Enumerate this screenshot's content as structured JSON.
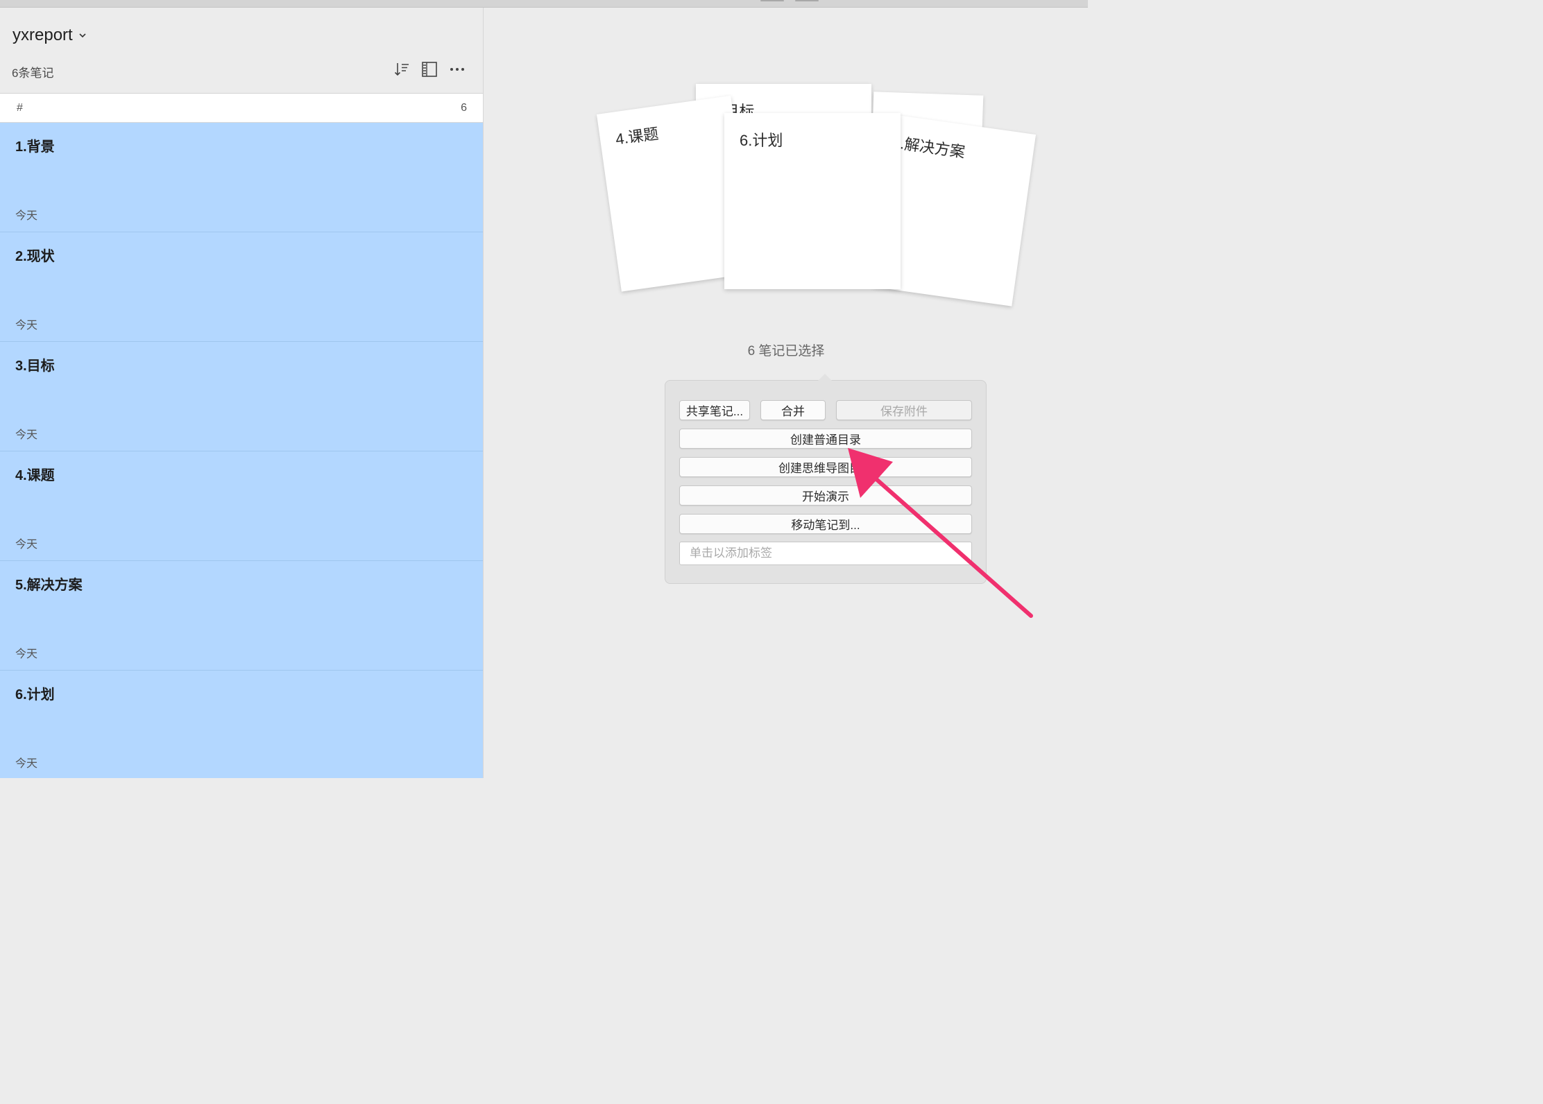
{
  "notebook": {
    "title": "yxreport",
    "note_count": "6条笔记"
  },
  "tag_row": {
    "tag": "#",
    "count": "6"
  },
  "notes": [
    {
      "title": "1.背景",
      "date": "今天"
    },
    {
      "title": "2.现状",
      "date": "今天"
    },
    {
      "title": "3.目标",
      "date": "今天"
    },
    {
      "title": "4.课题",
      "date": "今天"
    },
    {
      "title": "5.解决方案",
      "date": "今天"
    },
    {
      "title": "6.计划",
      "date": "今天"
    }
  ],
  "cards": {
    "back": "3.目标",
    "left": "4.课题",
    "center": "6.计划",
    "right": "5.解决方案"
  },
  "selection": {
    "label": "6 笔记已选择",
    "share": "共享笔记...",
    "merge": "合并",
    "save_attachments": "保存附件",
    "create_toc": "创建普通目录",
    "create_mindmap": "创建思维导图目录",
    "present": "开始演示",
    "move": "移动笔记到...",
    "tag_placeholder": "单击以添加标签"
  },
  "colors": {
    "selected_note_bg": "#b3d7ff",
    "annotation_arrow": "#f0306e"
  }
}
